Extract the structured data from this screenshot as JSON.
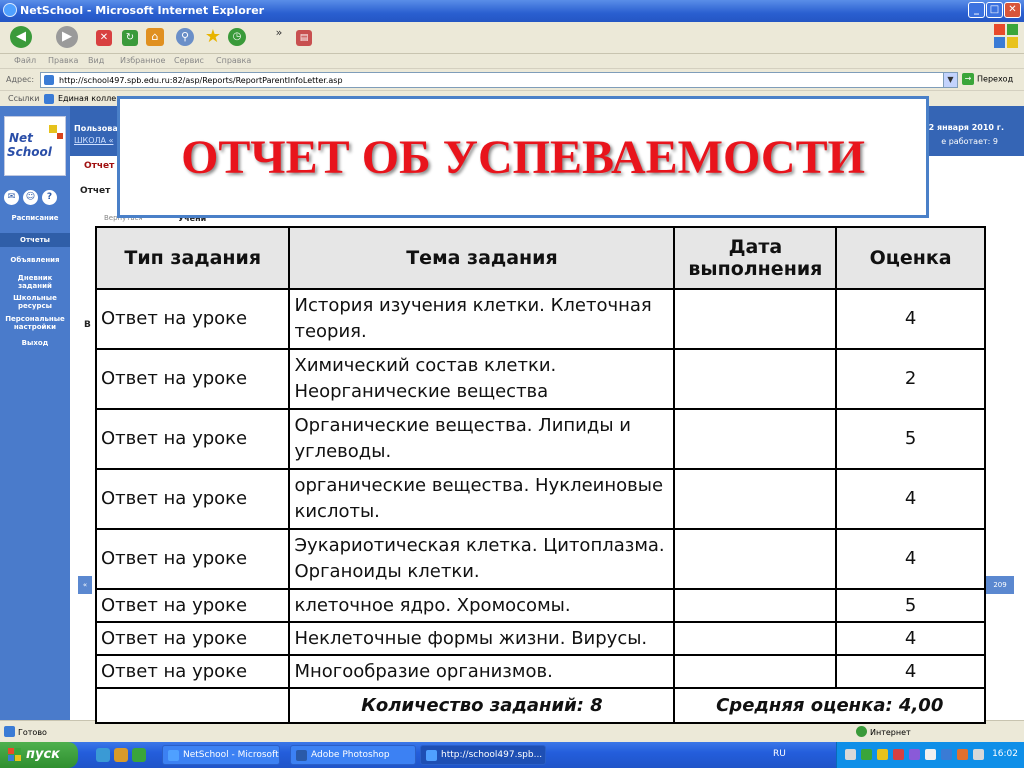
{
  "window": {
    "title": "NetSchool - Microsoft Internet Explorer",
    "min": "_",
    "max": "□",
    "close": "✕"
  },
  "menu": {
    "file": "Файл",
    "edit": "Правка",
    "view": "Вид",
    "favorites": "Избранное",
    "tools": "Сервис",
    "help": "Справка"
  },
  "address": {
    "label": "Адрес:",
    "url": "http://school497.spb.edu.ru:82/asp/Reports/ReportParentInfoLetter.asp",
    "go": "Переход"
  },
  "links": {
    "label": "Ссылки",
    "item": "Единая колле"
  },
  "header": {
    "user_prefix": "Пользова",
    "school_link": "ШКОЛА «",
    "date": "22 января 2010 г.",
    "online": "е работает: 9"
  },
  "sidebar": {
    "logo_net": "Net",
    "logo_school": "School",
    "items": [
      "Расписание",
      "Отчеты",
      "Объявления",
      "Дневник заданий",
      "Школьные ресурсы",
      "Персональные настройки",
      "Выход"
    ]
  },
  "page": {
    "tab_label": "Отчет",
    "sub_label": "Отчет",
    "back_link": "Вернуться",
    "student_label": "Учени",
    "side_letter": "В",
    "left_arrow": "«",
    "right_arrow": "209"
  },
  "overlay": {
    "title": "ОТЧЕТ ОБ УСПЕВАЕМОСТИ"
  },
  "table": {
    "headers": [
      "Тип задания",
      "Тема задания",
      "Дата выполнения",
      "Оценка"
    ],
    "rows": [
      {
        "type": "Ответ на уроке",
        "topic": "История изучения клетки. Клеточная теория.",
        "date": "",
        "grade": "4"
      },
      {
        "type": "Ответ на уроке",
        "topic": "Химический состав клетки. Неорганические вещества",
        "date": "",
        "grade": "2"
      },
      {
        "type": "Ответ на уроке",
        "topic": "Органические вещества. Липиды и углеводы.",
        "date": "",
        "grade": "5"
      },
      {
        "type": "Ответ на уроке",
        "topic": "органические вещества. Нуклеиновые кислоты.",
        "date": "",
        "grade": "4"
      },
      {
        "type": "Ответ на уроке",
        "topic": "Эукариотическая клетка. Цитоплазма. Органоиды клетки.",
        "date": "",
        "grade": "4"
      },
      {
        "type": "Ответ на уроке",
        "topic": "клеточное ядро. Хромосомы.",
        "date": "",
        "grade": "5"
      },
      {
        "type": "Ответ на уроке",
        "topic": "Неклеточные формы жизни. Вирусы.",
        "date": "",
        "grade": "4"
      },
      {
        "type": "Ответ на уроке",
        "topic": "Многообразие организмов.",
        "date": "",
        "grade": "4"
      }
    ],
    "footer_count": "Количество заданий: 8",
    "footer_avg": "Средняя оценка: 4,00"
  },
  "status": {
    "left": "Готово",
    "zone": "Интернет"
  },
  "taskbar": {
    "start": "пуск",
    "tasks": [
      "NetSchool - Microsoft...",
      "Adobe Photoshop",
      "http://school497.spb..."
    ],
    "lang": "RU",
    "clock": "16:02"
  }
}
